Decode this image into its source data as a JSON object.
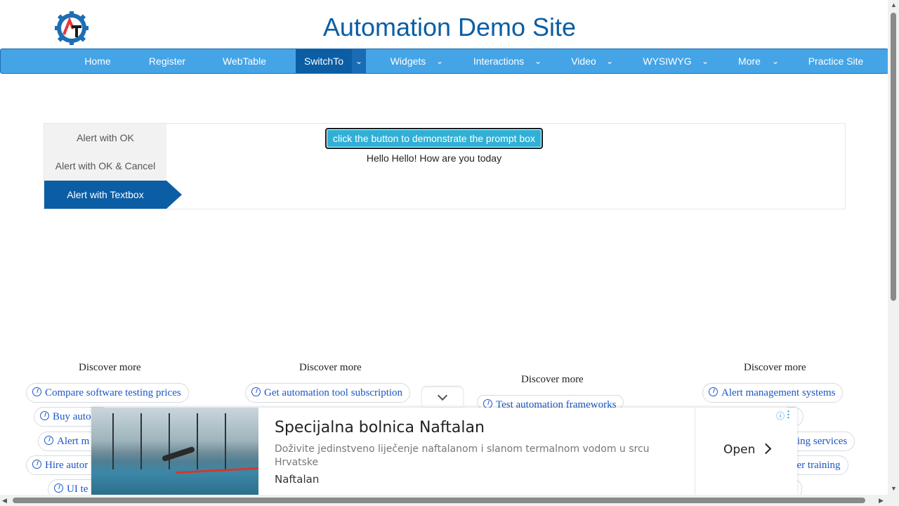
{
  "site": {
    "title": "Automation Demo Site",
    "logo_text": "AT"
  },
  "nav": {
    "items": [
      {
        "label": "Home"
      },
      {
        "label": "Register"
      },
      {
        "label": "WebTable"
      },
      {
        "label": "SwitchTo",
        "active": true
      },
      {
        "label": "Widgets"
      },
      {
        "label": "Interactions"
      },
      {
        "label": "Video"
      },
      {
        "label": "WYSIWYG"
      },
      {
        "label": "More"
      },
      {
        "label": "Practice Site"
      }
    ],
    "caret": "⌄"
  },
  "alerts": {
    "tabs": [
      {
        "label": "Alert with OK"
      },
      {
        "label": "Alert with OK & Cancel"
      },
      {
        "label": "Alert with Textbox",
        "active": true
      }
    ],
    "button_label": "click the button to demonstrate the prompt box",
    "result": "Hello Hello! How are you today"
  },
  "discover": {
    "heading": "Discover more",
    "col1": [
      "Compare software testing prices",
      "Buy auto",
      "Alert m",
      "Hire autor",
      "UI te"
    ],
    "col2": [
      "Get automation tool subscription"
    ],
    "col3": [
      "Test automation frameworks"
    ],
    "col4": [
      "Alert management systems",
      "sting services",
      "ver training",
      "s"
    ]
  },
  "ad": {
    "title": "Specijalna bolnica Naftalan",
    "description": "Doživite jedinstveno liječenje naftalanom i slanom termalnom vodom u srcu Hrvatske",
    "brand": "Naftalan",
    "cta": "Open",
    "info_icon": "ⓘ",
    "menu_icon": "⋮"
  },
  "colors": {
    "brand": "#0b5ea4",
    "nav_bg": "#45a4e6",
    "button": "#31b0d5",
    "link": "#1a56c7"
  }
}
